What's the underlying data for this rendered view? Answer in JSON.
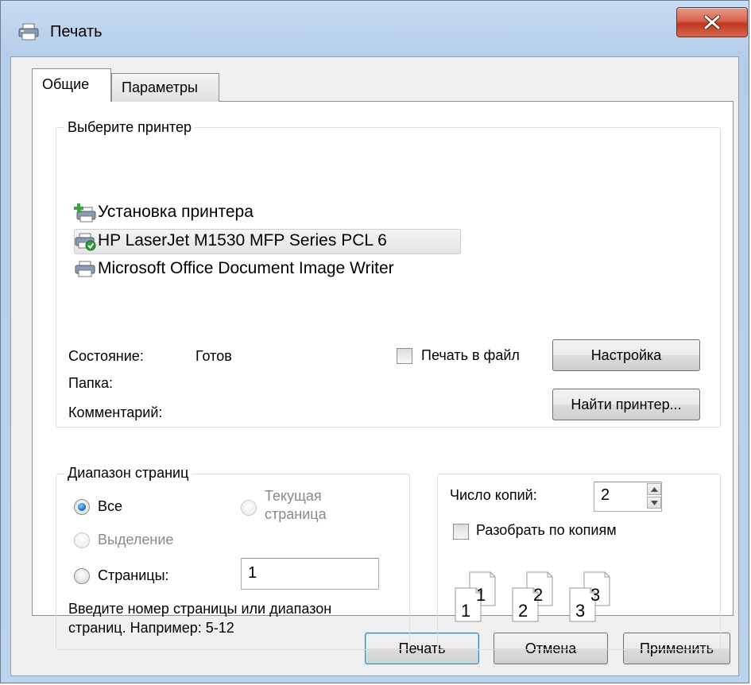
{
  "window": {
    "title": "Печать",
    "icons": {
      "title": "printer-icon",
      "close": "close-icon"
    },
    "accent_color": "#c2361f"
  },
  "tabs": [
    {
      "label": "Общие",
      "active": true
    },
    {
      "label": "Параметры",
      "active": false
    }
  ],
  "printer_group": {
    "title": "Выберите принтер",
    "printers": [
      {
        "label": "Установка принтера",
        "icon": "add-printer-icon"
      },
      {
        "label": "HP LaserJet M1530 MFP Series PCL 6",
        "icon": "default-printer-icon",
        "selected": true
      },
      {
        "label": "Microsoft Office Document Image Writer",
        "icon": "printer-icon"
      }
    ],
    "status_label": "Состояние:",
    "status_value": "Готов",
    "folder_label": "Папка:",
    "comment_label": "Комментарий:",
    "print_to_file_label": "Печать в файл",
    "print_to_file_checked": false,
    "setup_button": "Настройка",
    "find_printer_button": "Найти принтер..."
  },
  "range_group": {
    "title": "Диапазон страниц",
    "all_label": "Все",
    "current_page_label_line1": "Текущая",
    "current_page_label_line2": "страница",
    "selection_label": "Выделение",
    "pages_label": "Страницы:",
    "pages_value": "1",
    "hint_line1": "Введите номер страницы или диапазон",
    "hint_line2": "страниц.  Например: 5-12",
    "selected_option": "all"
  },
  "copies_group": {
    "copies_label": "Число копий:",
    "copies_value": "2",
    "collate_label": "Разобрать по копиям",
    "collate_checked": false,
    "collate_pages": [
      "1",
      "1",
      "2",
      "2",
      "3",
      "3"
    ]
  },
  "buttons": {
    "print": "Печать",
    "cancel": "Отмена",
    "apply": "Применить"
  }
}
